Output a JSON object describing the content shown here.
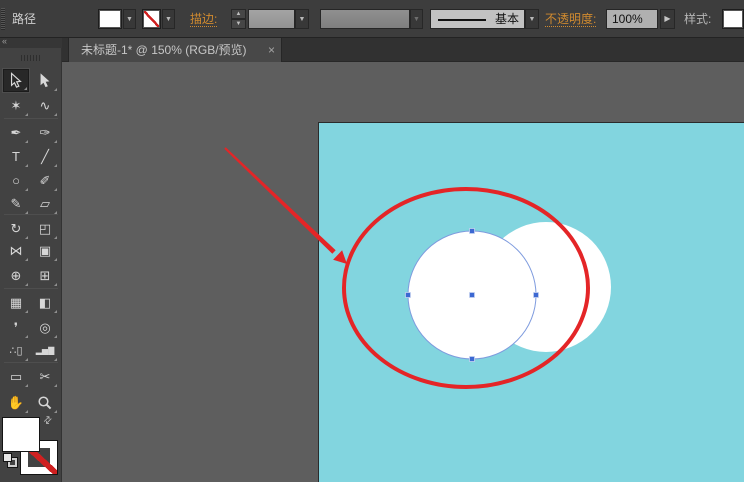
{
  "glyphs": {
    "collapse": "«",
    "dropdown": "▼",
    "up": "▲",
    "down": "▼",
    "play": "▶",
    "swap": "⇄",
    "close": "×"
  },
  "topbar": {
    "selection_label": "路径",
    "stroke_label": "描边:",
    "brush_name": "基本",
    "opacity_label": "不透明度:",
    "opacity_value": "100%",
    "style_label": "样式:"
  },
  "tab": {
    "title": "未标题-1* @ 150% (RGB/预览)"
  },
  "tools": {
    "magic_wand": "✶",
    "lasso": "∿",
    "pen": "✒",
    "curvature": "✑",
    "type": "T",
    "line_segment": "╱",
    "ellipse": "○",
    "paintbrush": "✐",
    "pencil": "✎",
    "eraser": "▱",
    "rotate": "↻",
    "scale": "◰",
    "width": "⋈",
    "free_transform": "▣",
    "shape_builder": "⊕",
    "perspective_grid": "⊞",
    "mesh": "▦",
    "gradient": "◧",
    "eyedropper": "❜",
    "blend": "◎",
    "symbol_sprayer": "∴▯",
    "column_graph": "▂▅▇",
    "artboard": "▭",
    "slice": "✂",
    "hand": "✋"
  },
  "canvas": {
    "artboard_color": "#82d5df",
    "shapes": [
      "white-circle",
      "selected-white-circle-with-anchors"
    ],
    "annotations": [
      "red-ellipse-highlight",
      "red-arrow-pointer"
    ]
  },
  "colors": {
    "annotation_red": "#e42527",
    "selection_blue": "#3c68d2",
    "path_outline_blue": "#7e9bde",
    "label_orange": "#d08a2f",
    "artboard_cyan": "#82d5df",
    "workspace_gray": "#5e5e5e"
  }
}
